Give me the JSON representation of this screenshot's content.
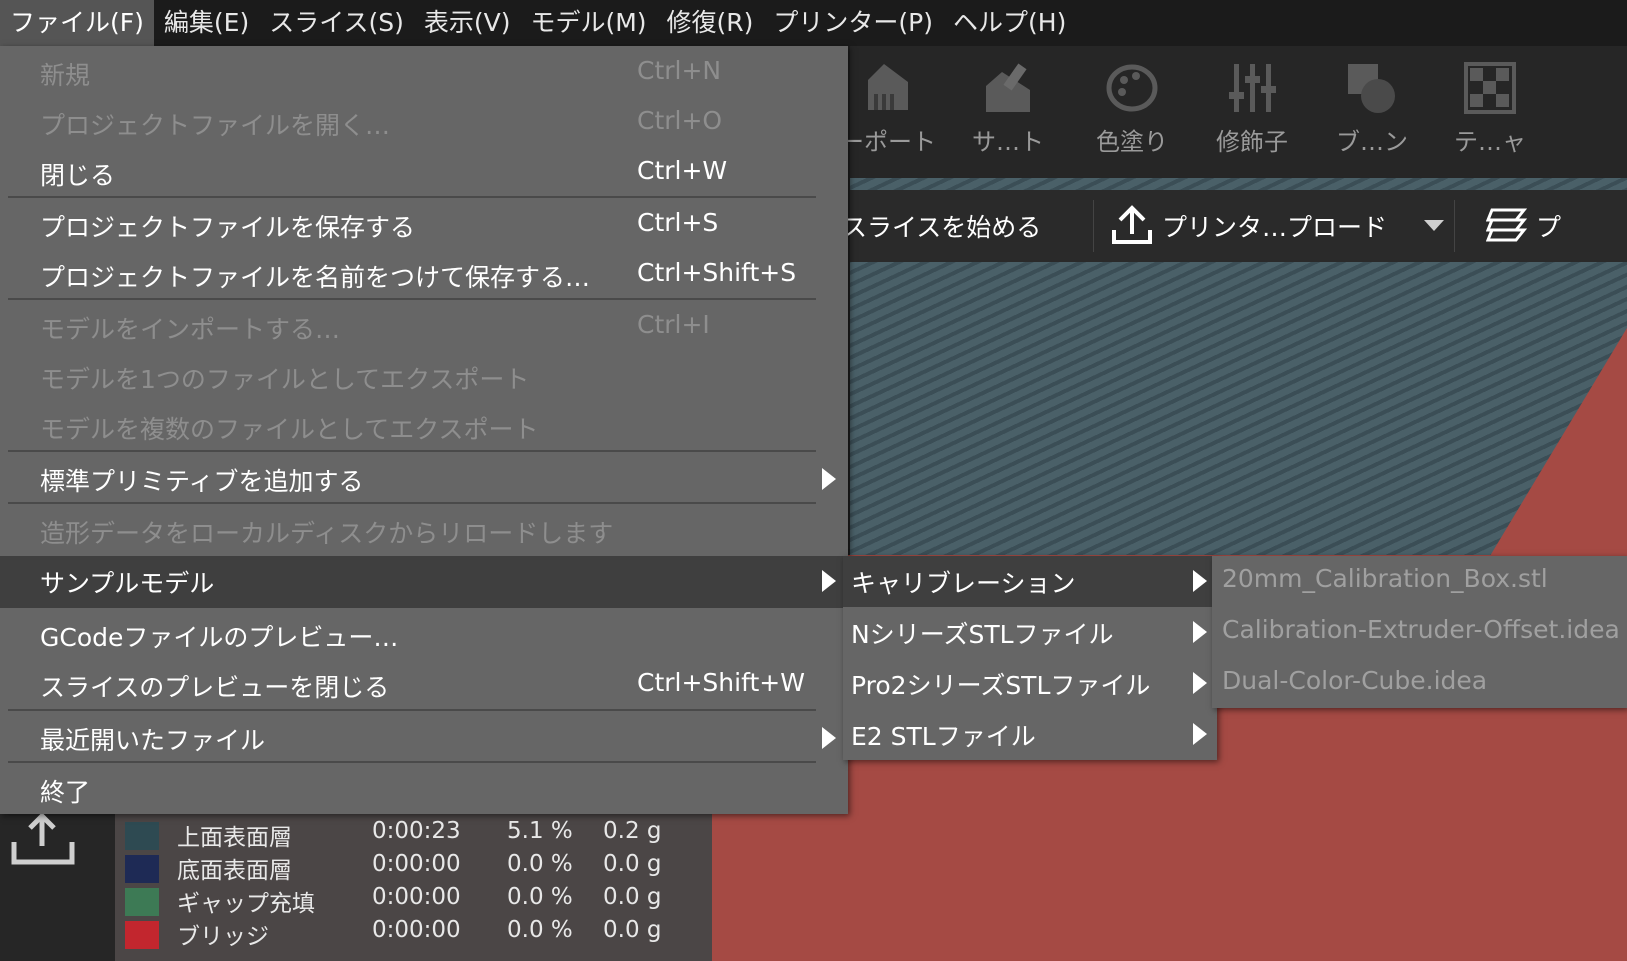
{
  "menubar": {
    "items": [
      {
        "label": "ファイル(F)",
        "active": true
      },
      {
        "label": "編集(E)"
      },
      {
        "label": "スライス(S)"
      },
      {
        "label": "表示(V)"
      },
      {
        "label": "モデル(M)"
      },
      {
        "label": "修復(R)"
      },
      {
        "label": "プリンター(P)"
      },
      {
        "label": "ヘルプ(H)"
      }
    ]
  },
  "toolbar": {
    "tools": [
      {
        "label": "ーポート",
        "icon": "support-icon"
      },
      {
        "label": "サ…ト",
        "icon": "support-paint-icon"
      },
      {
        "label": "色塗り",
        "icon": "palette-icon"
      },
      {
        "label": "修飾子",
        "icon": "modifier-sliders-icon"
      },
      {
        "label": "ブ…ン",
        "icon": "boolean-icon"
      },
      {
        "label": "テ…ャ",
        "icon": "texture-icon"
      }
    ]
  },
  "slicebar": {
    "start_slice": "スライスを始める",
    "upload": "プリンタ…プロード",
    "third": "プ"
  },
  "file_menu": {
    "items": [
      {
        "label": "新規",
        "shortcut": "Ctrl+N",
        "disabled": true
      },
      {
        "label": "プロジェクトファイルを開く…",
        "shortcut": "Ctrl+O",
        "disabled": true
      },
      {
        "label": "閉じる",
        "shortcut": "Ctrl+W"
      },
      {
        "label": "プロジェクトファイルを保存する",
        "shortcut": "Ctrl+S"
      },
      {
        "label": "プロジェクトファイルを名前をつけて保存する…",
        "shortcut": "Ctrl+Shift+S"
      },
      {
        "label": "モデルをインポートする…",
        "shortcut": "Ctrl+I",
        "disabled": true
      },
      {
        "label": "モデルを1つのファイルとしてエクスポート",
        "shortcut": "",
        "disabled": true
      },
      {
        "label": "モデルを複数のファイルとしてエクスポート",
        "shortcut": "",
        "disabled": true
      },
      {
        "label": "標準プリミティブを追加する",
        "shortcut": "",
        "submenu": true
      },
      {
        "label": "造形データをローカルディスクからリロードします",
        "shortcut": "",
        "disabled": true
      },
      {
        "label": "サンプルモデル",
        "shortcut": "",
        "submenu": true,
        "highlight": true
      },
      {
        "label": "GCodeファイルのプレビュー…",
        "shortcut": ""
      },
      {
        "label": "スライスのプレビューを閉じる",
        "shortcut": "Ctrl+Shift+W"
      },
      {
        "label": "最近開いたファイル",
        "shortcut": "",
        "submenu": true
      },
      {
        "label": "終了",
        "shortcut": ""
      }
    ]
  },
  "sample_submenu": {
    "items": [
      {
        "label": "キャリブレーション",
        "highlight": true
      },
      {
        "label": "NシリーズSTLファイル"
      },
      {
        "label": "Pro2シリーズSTLファイル"
      },
      {
        "label": "E2 STLファイル"
      }
    ]
  },
  "calibration_submenu": {
    "items": [
      {
        "label": "20mm_Calibration_Box.stl"
      },
      {
        "label": "Calibration-Extruder-Offset.idea"
      },
      {
        "label": "Dual-Color-Cube.idea"
      }
    ]
  },
  "stats": {
    "rows": [
      {
        "name": "上面表面層",
        "time": "0:00:23",
        "pct": "5.1 %",
        "mass": "0.2 g",
        "color": "#2e4a52"
      },
      {
        "name": "底面表面層",
        "time": "0:00:00",
        "pct": "0.0 %",
        "mass": "0.0 g",
        "color": "#1e2a55"
      },
      {
        "name": "ギャップ充填",
        "time": "0:00:00",
        "pct": "0.0 %",
        "mass": "0.0 g",
        "color": "#3d7a55"
      },
      {
        "name": "ブリッジ",
        "time": "0:00:00",
        "pct": "0.0 %",
        "mass": "0.0 g",
        "color": "#c2262e"
      }
    ]
  }
}
